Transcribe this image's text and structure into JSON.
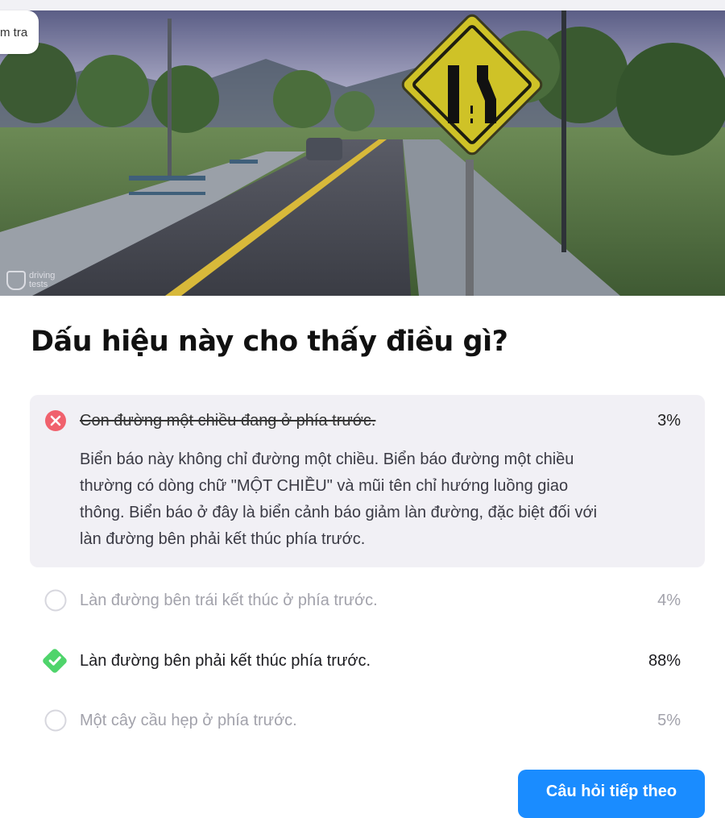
{
  "header": {
    "pill_label": "m tra",
    "watermark_line1": "driving",
    "watermark_line2": "tests"
  },
  "question": {
    "title": "Dấu hiệu này cho thấy điều gì?"
  },
  "options": [
    {
      "text": "Con đường một chiều đang ở phía trước.",
      "percent": "3%",
      "status": "incorrect-selected",
      "explanation": [
        "Biển báo này không chỉ đường một chiều. Biển báo đường một chiều",
        "thường có dòng chữ \"MỘT CHIỀU\" và mũi tên chỉ hướng luồng giao",
        "thông. Biển báo ở đây là biển cảnh báo giảm làn đường, đặc biệt đối với",
        "làn đường bên phải kết thúc phía trước."
      ]
    },
    {
      "text": "Làn đường bên trái kết thúc ở phía trước.",
      "percent": "4%",
      "status": "unselected"
    },
    {
      "text": "Làn đường bên phải kết thúc phía trước.",
      "percent": "88%",
      "status": "correct"
    },
    {
      "text": "Một cây cầu hẹp ở phía trước.",
      "percent": "5%",
      "status": "unselected"
    }
  ],
  "footer": {
    "next_button_label": "Câu hỏi tiếp theo"
  },
  "colors": {
    "incorrect": "#f0616d",
    "correct": "#4fd46b",
    "primary_button": "#1a8cff",
    "explanation_bg": "#f1f0f5",
    "sign_yellow": "#d4c72a"
  },
  "icons": {
    "incorrect": "x-circle-icon",
    "correct": "check-diamond-icon",
    "unselected": "empty-circle-icon"
  }
}
